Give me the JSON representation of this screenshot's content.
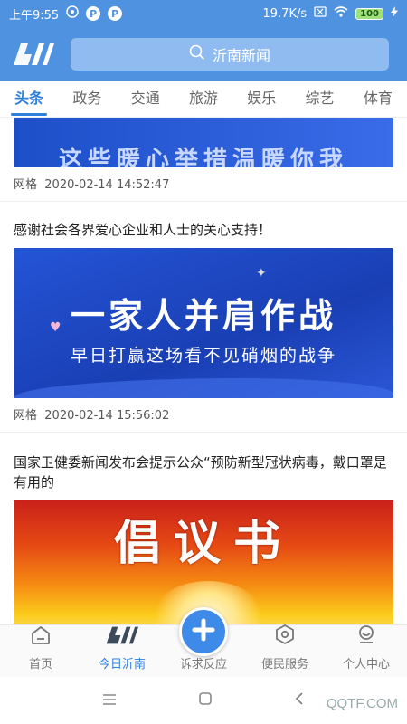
{
  "status_bar": {
    "time": "上午9:55",
    "speed": "19.7K/s",
    "battery": "100"
  },
  "header": {
    "search_text": "沂南新闻"
  },
  "tabs": [
    {
      "label": "头条",
      "active": true
    },
    {
      "label": "政务"
    },
    {
      "label": "交通"
    },
    {
      "label": "旅游"
    },
    {
      "label": "娱乐"
    },
    {
      "label": "综艺"
    },
    {
      "label": "体育"
    }
  ],
  "articles": [
    {
      "title": "",
      "banner_text": "这些暖心举措温暖你我",
      "source": "网格",
      "time": "2020-02-14 14:52:47"
    },
    {
      "title": "感谢社会各界爱心企业和人士的关心支持！",
      "banner_text": "一家人并肩作战",
      "banner_subtext": "早日打赢这场看不见硝烟的战争",
      "source": "网格",
      "time": "2020-02-14 15:56:02"
    },
    {
      "title": "国家卫健委新闻发布会提示公众“预防新型冠状病毒，戴口罩是有用的",
      "banner_text": "倡议书"
    }
  ],
  "bottom_nav": [
    {
      "label": "首页",
      "icon": "home-icon"
    },
    {
      "label": "今日沂南",
      "icon": "logo-icon",
      "active": true
    },
    {
      "label": "诉求反应",
      "icon": "plus-icon"
    },
    {
      "label": "便民服务",
      "icon": "hexagon-icon"
    },
    {
      "label": "个人中心",
      "icon": "user-icon"
    }
  ],
  "watermark": "QQTF.COM",
  "colors": {
    "primary": "#4f92e0",
    "accent": "#2f7fdc"
  }
}
